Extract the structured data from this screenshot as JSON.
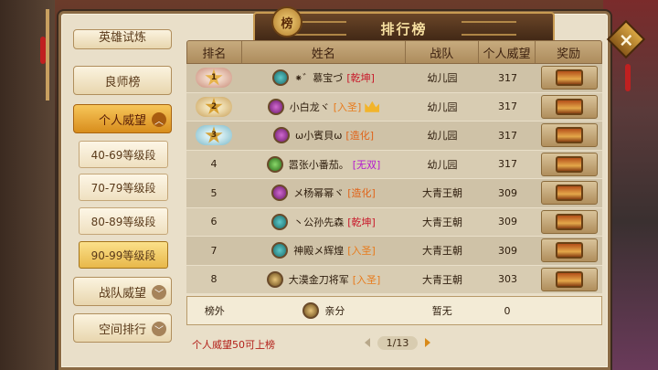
{
  "title": "排行榜",
  "title_emblem": "榜",
  "sidebar": {
    "top_partial": "英雄试炼",
    "items": [
      {
        "label": "良师榜"
      },
      {
        "label": "个人威望",
        "expanded": true
      },
      {
        "label": "战队威望"
      },
      {
        "label": "空间排行"
      }
    ],
    "sub_items": [
      {
        "label": "40-69等级段"
      },
      {
        "label": "70-79等级段"
      },
      {
        "label": "80-89等级段"
      },
      {
        "label": "90-99等级段",
        "selected": true
      }
    ]
  },
  "table": {
    "headers": [
      "排名",
      "姓名",
      "战队",
      "个人威望",
      "奖励"
    ],
    "rows": [
      {
        "rank": "1",
        "avatar": "teal",
        "name": "⁕゛慕宝づ",
        "tag": "[乾坤]",
        "tag_color": "#c8182a",
        "team": "幼儿园",
        "prestige": "317"
      },
      {
        "rank": "2",
        "avatar": "purple",
        "name": "小白龙ヾ",
        "tag": "[入圣]",
        "tag_color": "#e87a1a",
        "crown": true,
        "team": "幼儿园",
        "prestige": "317"
      },
      {
        "rank": "3",
        "avatar": "purple",
        "name": "ω小賓貝ω",
        "tag": "[造化]",
        "tag_color": "#e0641a",
        "team": "幼儿园",
        "prestige": "317"
      },
      {
        "rank": "4",
        "avatar": "green",
        "name": "嚣张小番茄。",
        "tag": "[无双]",
        "tag_color": "#b41ad0",
        "team": "幼儿园",
        "prestige": "317"
      },
      {
        "rank": "5",
        "avatar": "purple",
        "name": "メ杨幂幂ヾ",
        "tag": "[造化]",
        "tag_color": "#e0641a",
        "team": "大青王朝",
        "prestige": "309"
      },
      {
        "rank": "6",
        "avatar": "teal",
        "name": "丶公孙先森",
        "tag": "[乾坤]",
        "tag_color": "#c8182a",
        "team": "大青王朝",
        "prestige": "309"
      },
      {
        "rank": "7",
        "avatar": "teal",
        "name": "神殿メ辉煌",
        "tag": "[入圣]",
        "tag_color": "#e87a1a",
        "team": "大青王朝",
        "prestige": "309"
      },
      {
        "rank": "8",
        "avatar": "gold",
        "name": "大漠金刀将军",
        "tag": "[入圣]",
        "tag_color": "#e87a1a",
        "team": "大青王朝",
        "prestige": "303"
      }
    ]
  },
  "my_row": {
    "rank": "榜外",
    "name": "亲分",
    "team": "暂无",
    "prestige": "0"
  },
  "footer_note": "个人威望50可上榜",
  "pager": {
    "current": "1/13"
  },
  "colors": {
    "panel": "#e9dfc9",
    "accent": "#d88d1c",
    "tag_red": "#c8182a"
  }
}
